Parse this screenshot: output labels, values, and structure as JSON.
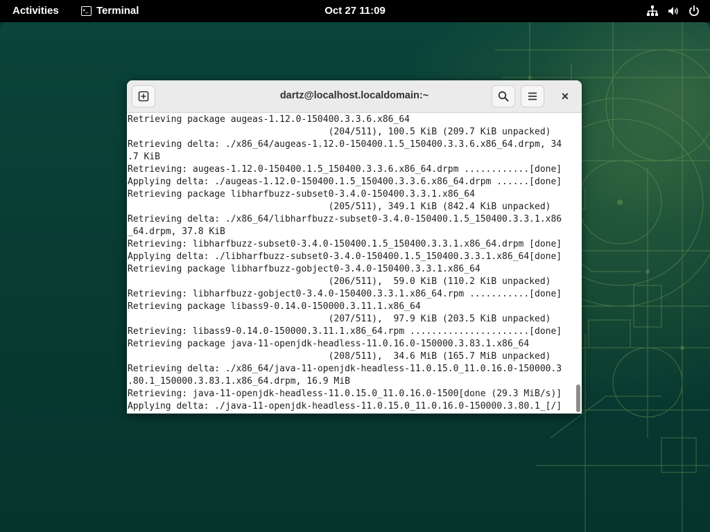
{
  "topbar": {
    "activities": "Activities",
    "app_name": "Terminal",
    "app_icon": ">_",
    "clock": "Oct 27  11:09",
    "tray_icons": [
      "network-icon",
      "volume-icon",
      "power-icon"
    ]
  },
  "window": {
    "title": "dartz@localhost.localdomain:~",
    "buttons": {
      "new_tab": "new-tab-icon",
      "search": "search-icon",
      "menu": "hamburger-menu-icon",
      "close": "×"
    },
    "terminal_lines": [
      "Retrieving package augeas-1.12.0-150400.3.3.6.x86_64",
      "                                     (204/511), 100.5 KiB (209.7 KiB unpacked)",
      "Retrieving delta: ./x86_64/augeas-1.12.0-150400.1.5_150400.3.3.6.x86_64.drpm, 34",
      ".7 KiB",
      "Retrieving: augeas-1.12.0-150400.1.5_150400.3.3.6.x86_64.drpm ............[done]",
      "Applying delta: ./augeas-1.12.0-150400.1.5_150400.3.3.6.x86_64.drpm ......[done]",
      "Retrieving package libharfbuzz-subset0-3.4.0-150400.3.3.1.x86_64",
      "                                     (205/511), 349.1 KiB (842.4 KiB unpacked)",
      "Retrieving delta: ./x86_64/libharfbuzz-subset0-3.4.0-150400.1.5_150400.3.3.1.x86",
      "_64.drpm, 37.8 KiB",
      "Retrieving: libharfbuzz-subset0-3.4.0-150400.1.5_150400.3.3.1.x86_64.drpm [done]",
      "Applying delta: ./libharfbuzz-subset0-3.4.0-150400.1.5_150400.3.3.1.x86_64[done]",
      "Retrieving package libharfbuzz-gobject0-3.4.0-150400.3.3.1.x86_64",
      "                                     (206/511),  59.0 KiB (110.2 KiB unpacked)",
      "Retrieving: libharfbuzz-gobject0-3.4.0-150400.3.3.1.x86_64.rpm ...........[done]",
      "Retrieving package libass9-0.14.0-150000.3.11.1.x86_64",
      "                                     (207/511),  97.9 KiB (203.5 KiB unpacked)",
      "Retrieving: libass9-0.14.0-150000.3.11.1.x86_64.rpm ......................[done]",
      "Retrieving package java-11-openjdk-headless-11.0.16.0-150000.3.83.1.x86_64",
      "                                     (208/511),  34.6 MiB (165.7 MiB unpacked)",
      "Retrieving delta: ./x86_64/java-11-openjdk-headless-11.0.15.0_11.0.16.0-150000.3",
      ".80.1_150000.3.83.1.x86_64.drpm, 16.9 MiB",
      "Retrieving: java-11-openjdk-headless-11.0.15.0_11.0.16.0-1500[done (29.3 MiB/s)]",
      "Applying delta: ./java-11-openjdk-headless-11.0.15.0_11.0.16.0-150000.3.80.1_[/]"
    ]
  },
  "colors": {
    "topbar_bg": "#000000",
    "desktop_bg": "#0a443a",
    "headerbar_bg": "#ebebeb",
    "terminal_bg": "#ffffff",
    "terminal_fg": "#1e1e1e"
  }
}
